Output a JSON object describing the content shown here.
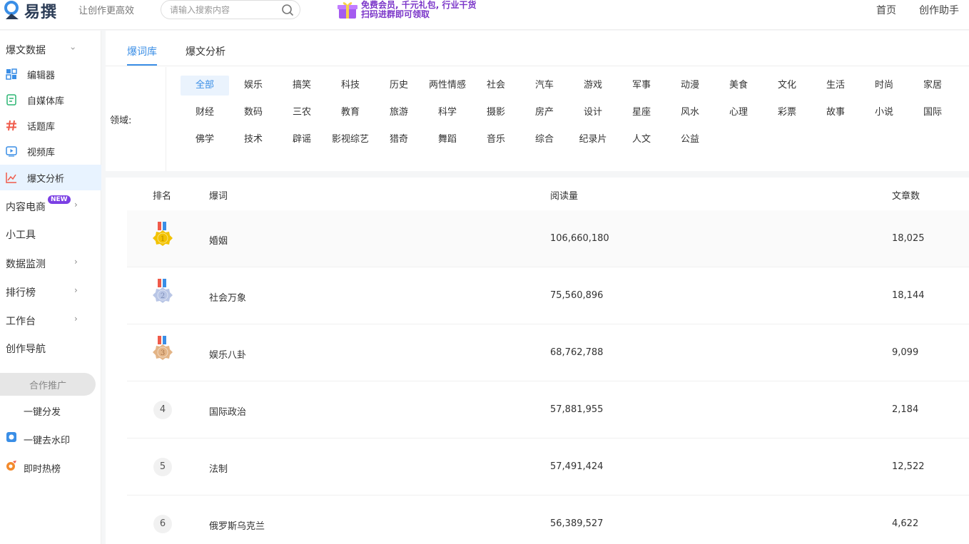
{
  "header": {
    "logo_text": "易撰",
    "slogan": "让创作更高效",
    "search_placeholder": "请输入搜索内容",
    "promo_line1": "免费会员, 千元礼包, 行业干货",
    "promo_line2": "扫码进群即可领取",
    "nav": [
      "首页",
      "创作助手"
    ]
  },
  "sidebar": {
    "group_baowen": "爆文数据",
    "items": [
      {
        "label": "编辑器",
        "icon": "grid-icon"
      },
      {
        "label": "自媒体库",
        "icon": "document-icon"
      },
      {
        "label": "话题库",
        "icon": "hashtag-icon"
      },
      {
        "label": "视频库",
        "icon": "video-icon"
      },
      {
        "label": "爆文分析",
        "icon": "chart-line-icon"
      }
    ],
    "group_neirong": "内容电商",
    "new_badge": "NEW",
    "group_tools": "小工具",
    "group_monitor": "数据监测",
    "group_rank": "排行榜",
    "group_workbench": "工作台",
    "group_nav": "创作导航",
    "coop_btn": "合作推广",
    "onekey_dist": "一键分发",
    "watermark": "一键去水印",
    "hot": "即时热榜"
  },
  "tabs": [
    "爆词库",
    "爆文分析"
  ],
  "domain": {
    "label": "领域:",
    "rows": [
      [
        "全部",
        "娱乐",
        "搞笑",
        "科技",
        "历史",
        "两性情感",
        "社会",
        "汽车",
        "游戏",
        "军事",
        "动漫",
        "美食",
        "文化",
        "生活",
        "时尚",
        "家居"
      ],
      [
        "财经",
        "数码",
        "三农",
        "教育",
        "旅游",
        "科学",
        "摄影",
        "房产",
        "设计",
        "星座",
        "风水",
        "心理",
        "彩票",
        "故事",
        "小说",
        "国际"
      ],
      [
        "佛学",
        "技术",
        "辟谣",
        "影视综艺",
        "猎奇",
        "舞蹈",
        "音乐",
        "综合",
        "纪录片",
        "人文",
        "公益"
      ]
    ]
  },
  "table": {
    "headers": [
      "排名",
      "爆词",
      "阅读量",
      "文章数"
    ],
    "rows": [
      {
        "rank": "1",
        "word": "婚姻",
        "reads": "106,660,180",
        "articles": "18,025"
      },
      {
        "rank": "2",
        "word": "社会万象",
        "reads": "75,560,896",
        "articles": "18,144"
      },
      {
        "rank": "3",
        "word": "娱乐八卦",
        "reads": "68,762,788",
        "articles": "9,099"
      },
      {
        "rank": "4",
        "word": "国际政治",
        "reads": "57,881,955",
        "articles": "2,184"
      },
      {
        "rank": "5",
        "word": "法制",
        "reads": "57,491,424",
        "articles": "12,522"
      },
      {
        "rank": "6",
        "word": "俄罗斯乌克兰",
        "reads": "56,389,527",
        "articles": "4,622"
      }
    ]
  },
  "colors": {
    "accent": "#3a8ee6",
    "gold": "#f2c200",
    "silver": "#b9c6e6",
    "bronze": "#e3b486",
    "new_badge": "#7b3fe4"
  }
}
